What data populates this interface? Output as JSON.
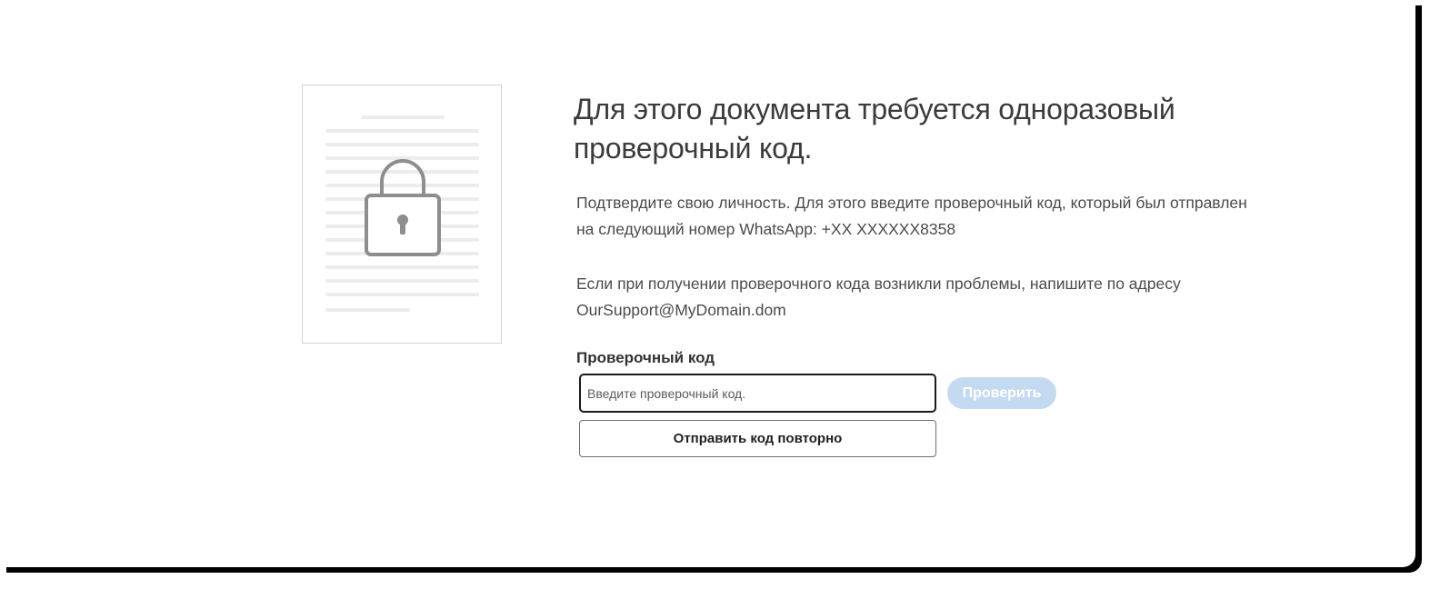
{
  "heading": "Для этого документа требуется одноразовый проверочный код.",
  "instructions": "Подтвердите свою личность. Для этого введите проверочный код, который был отправлен на следующий номер WhatsApp: +XX XXXXXX8358",
  "support_note": "Если при получении проверочного кода возникли проблемы, напишите по адресу OurSupport@MyDomain.dom",
  "code_field": {
    "label": "Проверочный код",
    "placeholder": "Введите проверочный код.",
    "value": ""
  },
  "verify_button": {
    "label": "Проверить",
    "color": "#c4daf0",
    "state": "disabled"
  },
  "resend_button": {
    "label": "Отправить код повторно"
  },
  "illustration": {
    "icon": "locked-document-icon",
    "lock_color": "#8e8e8e",
    "line_color": "#ececec"
  }
}
